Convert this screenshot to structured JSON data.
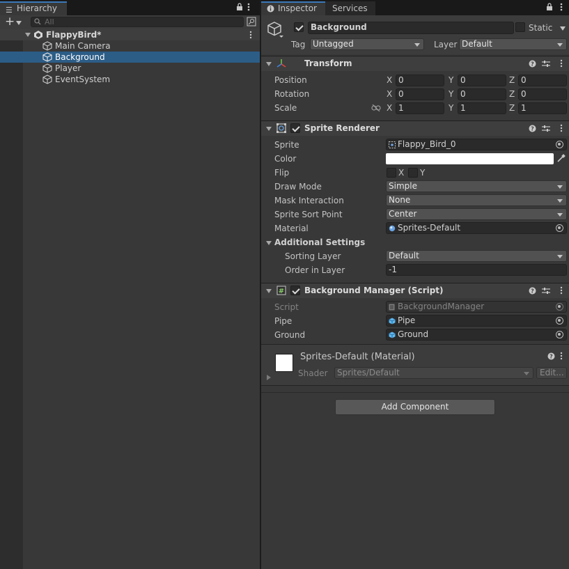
{
  "hierarchy": {
    "tab_label": "Hierarchy",
    "search_placeholder": "All",
    "scene_name": "FlappyBird*",
    "items": [
      {
        "label": "Main Camera"
      },
      {
        "label": "Background",
        "selected": true
      },
      {
        "label": "Player"
      },
      {
        "label": "EventSystem"
      }
    ]
  },
  "inspector": {
    "tabs": [
      {
        "label": "Inspector"
      },
      {
        "label": "Services"
      }
    ],
    "object_name": "Background",
    "static_label": "Static",
    "tag_label": "Tag",
    "tag_value": "Untagged",
    "layer_label": "Layer",
    "layer_value": "Default",
    "transform": {
      "title": "Transform",
      "position": {
        "label": "Position",
        "x": "0",
        "y": "0",
        "z": "0"
      },
      "rotation": {
        "label": "Rotation",
        "x": "0",
        "y": "0",
        "z": "0"
      },
      "scale": {
        "label": "Scale",
        "x": "1",
        "y": "1",
        "z": "1"
      },
      "axis_x": "X",
      "axis_y": "Y",
      "axis_z": "Z"
    },
    "sprite_renderer": {
      "title": "Sprite Renderer",
      "sprite_label": "Sprite",
      "sprite_value": "Flappy_Bird_0",
      "color_label": "Color",
      "color_value": "#ffffff",
      "flip_label": "Flip",
      "flip_x": "X",
      "flip_y": "Y",
      "draw_mode_label": "Draw Mode",
      "draw_mode_value": "Simple",
      "mask_label": "Mask Interaction",
      "mask_value": "None",
      "sort_point_label": "Sprite Sort Point",
      "sort_point_value": "Center",
      "material_label": "Material",
      "material_value": "Sprites-Default",
      "additional_label": "Additional Settings",
      "sorting_layer_label": "Sorting Layer",
      "sorting_layer_value": "Default",
      "order_label": "Order in Layer",
      "order_value": "-1"
    },
    "bg_manager": {
      "title": "Background Manager (Script)",
      "script_label": "Script",
      "script_value": "BackgroundManager",
      "pipe_label": "Pipe",
      "pipe_value": "Pipe",
      "ground_label": "Ground",
      "ground_value": "Ground"
    },
    "material": {
      "title": "Sprites-Default (Material)",
      "shader_label": "Shader",
      "shader_value": "Sprites/Default",
      "edit_label": "Edit..."
    },
    "add_component_label": "Add Component"
  },
  "colors": {
    "selection": "#2c5d87",
    "tab_accent": "#3a79bb"
  }
}
